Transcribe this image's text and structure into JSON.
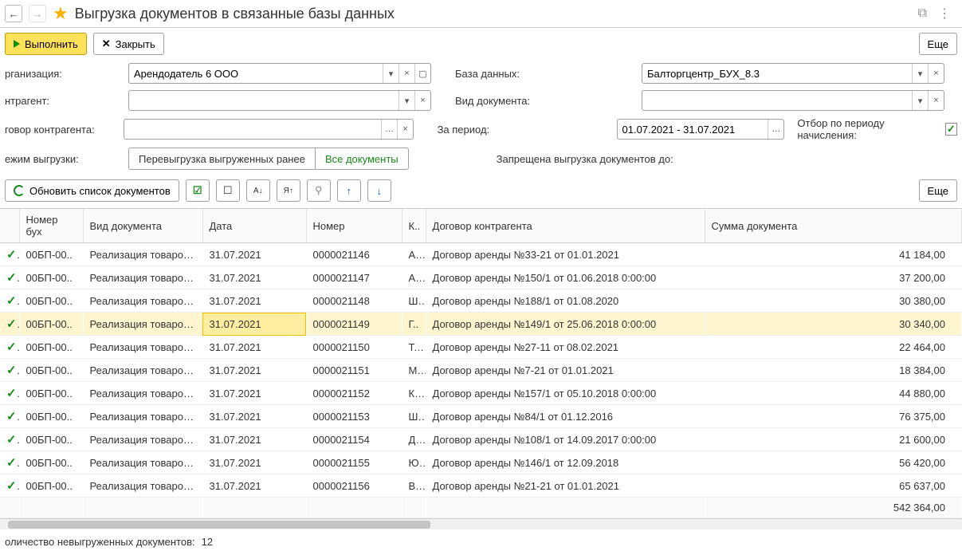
{
  "title": "Выгрузка документов в связанные базы данных",
  "cmd": {
    "execute": "Выполнить",
    "close": "Закрыть",
    "more": "Еще"
  },
  "form": {
    "org_lbl": "рганизация:",
    "org_val": "Арендодатель 6 ООО",
    "db_lbl": "База данных:",
    "db_val": "Балторгцентр_БУХ_8.3",
    "contr_lbl": "нтрагент:",
    "contr_val": "",
    "doctype_lbl": "Вид документа:",
    "doctype_val": "",
    "contract_lbl": "говор контрагента:",
    "contract_val": "",
    "period_lbl": "За период:",
    "period_val": "01.07.2021 - 31.07.2021",
    "period_filter_lbl": "Отбор по периоду начисления:",
    "mode_lbl": "ежим выгрузки:",
    "seg_reload": "Перевыгрузка выгруженных ранее",
    "seg_all": "Все документы",
    "forbidden_lbl": "Запрещена выгрузка документов до:"
  },
  "toolbar2": {
    "refresh": "Обновить список документов",
    "more": "Еще"
  },
  "table": {
    "headers": {
      "chk": "",
      "num_acc": "Номер бух",
      "doctype": "Вид документа",
      "date": "Дата",
      "num": "Номер",
      "k": "К..",
      "contract": "Договор контрагента",
      "sum": "Сумма документа"
    },
    "rows": [
      {
        "num_acc": "00БП-00..",
        "doctype": "Реализация товаров ...",
        "date": "31.07.2021",
        "num": "0000021146",
        "k": "А..",
        "contract": "Договор аренды №33-21 от 01.01.2021",
        "sum": "41 184,00"
      },
      {
        "num_acc": "00БП-00..",
        "doctype": "Реализация товаров ...",
        "date": "31.07.2021",
        "num": "0000021147",
        "k": "А..",
        "contract": "Договор аренды №150/1 от 01.06.2018 0:00:00",
        "sum": "37 200,00"
      },
      {
        "num_acc": "00БП-00..",
        "doctype": "Реализация товаров ...",
        "date": "31.07.2021",
        "num": "0000021148",
        "k": "Ш..",
        "contract": "Договор аренды №188/1 от 01.08.2020",
        "sum": "30 380,00"
      },
      {
        "num_acc": "00БП-00..",
        "doctype": "Реализация товаров ...",
        "date": "31.07.2021",
        "num": "0000021149",
        "k": "Г..",
        "contract": "Договор аренды №149/1 от 25.06.2018 0:00:00",
        "sum": "30 340,00",
        "selected": true
      },
      {
        "num_acc": "00БП-00..",
        "doctype": "Реализация товаров ...",
        "date": "31.07.2021",
        "num": "0000021150",
        "k": "Т..",
        "contract": "Договор аренды №27-11 от 08.02.2021",
        "sum": "22 464,00"
      },
      {
        "num_acc": "00БП-00..",
        "doctype": "Реализация товаров ...",
        "date": "31.07.2021",
        "num": "0000021151",
        "k": "М..",
        "contract": "Договор аренды №7-21 от 01.01.2021",
        "sum": "18 384,00"
      },
      {
        "num_acc": "00БП-00..",
        "doctype": "Реализация товаров ...",
        "date": "31.07.2021",
        "num": "0000021152",
        "k": "К..",
        "contract": "Договор аренды №157/1 от 05.10.2018 0:00:00",
        "sum": "44 880,00"
      },
      {
        "num_acc": "00БП-00..",
        "doctype": "Реализация товаров ...",
        "date": "31.07.2021",
        "num": "0000021153",
        "k": "Ш..",
        "contract": "Договор аренды №84/1 от 01.12.2016",
        "sum": "76 375,00"
      },
      {
        "num_acc": "00БП-00..",
        "doctype": "Реализация товаров ...",
        "date": "31.07.2021",
        "num": "0000021154",
        "k": "Д..",
        "contract": "Договор аренды №108/1 от 14.09.2017 0:00:00",
        "sum": "21 600,00"
      },
      {
        "num_acc": "00БП-00..",
        "doctype": "Реализация товаров ...",
        "date": "31.07.2021",
        "num": "0000021155",
        "k": "Ю..",
        "contract": "Договор аренды №146/1 от 12.09.2018",
        "sum": "56 420,00"
      },
      {
        "num_acc": "00БП-00..",
        "doctype": "Реализация товаров ...",
        "date": "31.07.2021",
        "num": "0000021156",
        "k": "В..",
        "contract": "Договор аренды №21-21 от 01.01.2021",
        "sum": "65 637,00"
      }
    ],
    "total": "542 364,00"
  },
  "footer": {
    "label": "оличество невыгруженных документов:",
    "count": "12"
  }
}
